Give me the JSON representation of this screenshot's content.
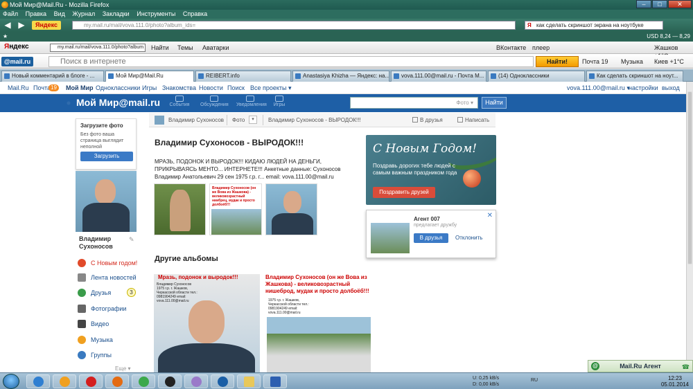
{
  "window": {
    "title": "Мой Мир@Mail.Ru - Mozilla Firefox",
    "controls": [
      "–",
      "□",
      "✕"
    ]
  },
  "menu": [
    "Файл",
    "Правка",
    "Вид",
    "Журнал",
    "Закладки",
    "Инструменты",
    "Справка"
  ],
  "navbar": {
    "yandex_label": "Яндекс",
    "url": "my.mail.ru/mail/vova.111.0/photo?album_ids=",
    "search_value": "как сделать скриншот экрана на ноутбуке"
  },
  "bookmarks_bar": {
    "currency": "USD 8,24 — 8,29"
  },
  "yandex_bar": {
    "logo_left": "Я",
    "logo_right": "ндекс",
    "url_value": "my.mail.ru/mail/vova.111.0/photo?album",
    "find": "Найти",
    "themes": "Темы",
    "avatars": "Аватарки",
    "vk": "ВКонтакте",
    "player": "плеер",
    "city": "Жашков +1°С"
  },
  "mail_bar": {
    "logo": "@mail.ru",
    "search_placeholder": "Поиск в интернете",
    "find_button": "Найти!",
    "mail": "Почта 19",
    "music": "Музыка",
    "weather": "Киев +1°С"
  },
  "tabs": [
    "Новый комментарий в блоге - ...",
    "Мой Мир@Mail.Ru",
    "REIBERT.info",
    "Anastasiya Khizha — Яндекс: на...",
    "vova.111.00@mail.ru - Почта М...",
    "(14) Одноклассники",
    "Как сделать скриншот на ноут..."
  ],
  "topnav": {
    "mailru": "Mail.Ru",
    "mail": "Почта",
    "mail_count": "19",
    "mymir": "Мой Мир",
    "odnoklassniki": "Одноклассники",
    "games": "Игры",
    "znakomstva": "Знакомства",
    "news": "Новости",
    "search": "Поиск",
    "all_projects": "Все проекты ▾",
    "user_email": "vova.111.00@mail.ru ▾",
    "settings": "настройки",
    "logout": "выход"
  },
  "mirhead": {
    "logo": "Мой Мир@mail.ru",
    "items": [
      "События",
      "Обсуждения",
      "Уведомления",
      "Игры"
    ],
    "search_placeholder": "Фото ▾",
    "find_button": "Найти"
  },
  "sidebar": {
    "upload_title": "Загрузите фото",
    "upload_hint": "Без фото ваша страница выглядит неполной",
    "upload_button": "Загрузить",
    "profile_name": "Владимир Сухоносов",
    "menu": [
      {
        "label": "С Новым годом!",
        "count": ""
      },
      {
        "label": "Лента новостей",
        "count": ""
      },
      {
        "label": "Друзья",
        "count": "3"
      },
      {
        "label": "Фотографии",
        "count": ""
      },
      {
        "label": "Видео",
        "count": ""
      },
      {
        "label": "Музыка",
        "count": ""
      },
      {
        "label": "Группы",
        "count": ""
      }
    ],
    "more": "Еще ▾"
  },
  "breadcrumbs": {
    "user": "Владимир Сухоносов",
    "section": "Фото",
    "dropdown": "▾",
    "album": "Владимир Сухоносов - ВЫРОДОК!!!",
    "add_friend": "В друзья",
    "write": "Написать"
  },
  "album": {
    "title": "Владимир Сухоносов - ВЫРОДОК!!!",
    "description": "МРАЗЬ, ПОДОНОК И ВЫРОДОК!!! КИДАЮ ЛЮДЕЙ НА ДЕНЬГИ, ПРИКРЫВАЯСЬ МЕНТО... ИНТЕРНЕТЕ!!! Анкетные данные: Сухоносов Владимир Анатольевич 29 сен 1975 г.р. г... email: vova.111.00@mail.ru",
    "thumb2_text": "Владимир Сухоносов (он же Вова из Жашкова) - великовозрастный ниибрец, мудак и просто долбоёб!!!"
  },
  "promo": {
    "heading": "С Новым Годом!",
    "text": "Поздравь дорогих тебе людей с самым важным праздником года",
    "button": "Поздравить друзей"
  },
  "suggest": {
    "name": "Агент 007",
    "subtitle": "предлагает дружбу",
    "accept": "В друзья",
    "reject": "Отклонить",
    "close": "✕"
  },
  "other_albums": {
    "title": "Другие альбомы",
    "album1_caption": "Мразь, подонок и выродок!!!",
    "album1_info": "Владимир Сухоносов 1975 г.р. г. Жашков, Черкасской области тел.: 0981904249 email: vova.111.00@mail.ru",
    "album2_caption": "Владимир Сухоносов (он же Вова из Жашкова) - великовозрастный нишеброд, мудак и просто долбоёб!!!",
    "album2_info": "1975 г.р. г. Жашков, Черкасской области тел.: 0981904249 email: vova.111.00@mail.ru"
  },
  "agent": {
    "label": "Mail.Ru Агент",
    "icon": "@"
  },
  "taskbar": {
    "rate_up": "U:   0,25 kB/s",
    "rate_down": "D:   0,00 kB/s",
    "lang": "RU",
    "time": "12:23",
    "date": "05.01.2014"
  },
  "colors": {
    "accent": "#1e5fa6",
    "promo_button": "#d94c3a",
    "friend_button": "#3b7ac6"
  }
}
